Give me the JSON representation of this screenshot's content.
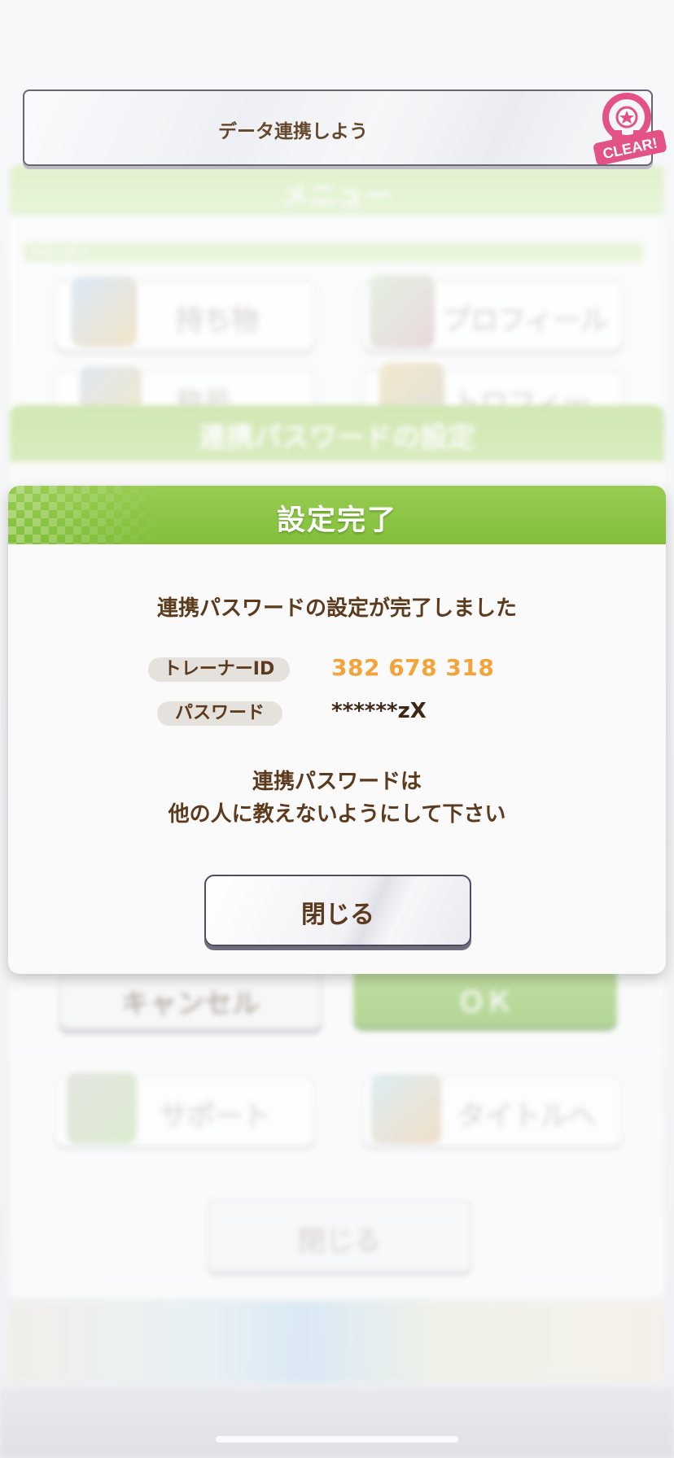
{
  "mission": {
    "title": "データ連携しよう",
    "badge": "CLEAR!"
  },
  "background_menu": {
    "title": "メニュー",
    "section": "トレーナー",
    "buttons": [
      "持ち物",
      "プロフィール",
      "称号",
      "トロフィー",
      "サポート",
      "タイトルへ"
    ],
    "close": "閉じる"
  },
  "background_dialog": {
    "title": "連携パスワードの設定",
    "cancel": "キャンセル",
    "ok": "ＯＫ"
  },
  "dialog": {
    "title": "設定完了",
    "message": "連携パスワードの設定が完了しました",
    "trainer_id_label": "トレーナーID",
    "trainer_id_value": "382 678 318",
    "password_label": "パスワード",
    "password_value": "******zX",
    "warning_line1": "連携パスワードは",
    "warning_line2": "他の人に教えないようにして下さい",
    "close_button": "閉じる"
  },
  "colors": {
    "header_green": "#82bf3a",
    "text_brown": "#5b3a1d",
    "id_orange": "#f2a43a",
    "badge_pink": "#e0447a"
  }
}
